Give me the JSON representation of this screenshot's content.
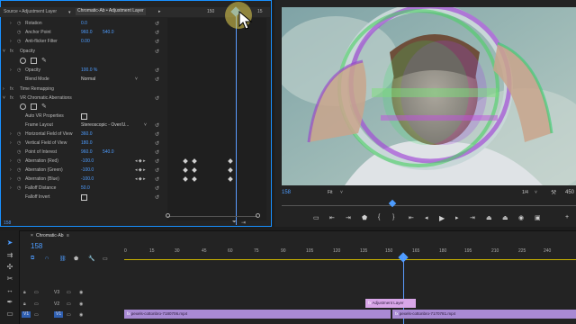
{
  "effect_controls": {
    "source_label": "Source • Adjustment Layer",
    "clip_label": "Chromatic-Ab • Adjustment Layer",
    "timecode_ruler": [
      "150",
      "15"
    ],
    "current_time": "158",
    "rows": [
      {
        "label": "Rotation",
        "v1": "0.0",
        "v2": ""
      },
      {
        "label": "Anchor Point",
        "v1": "960.0",
        "v2": "540.0"
      },
      {
        "label": "Anti-flicker Filter",
        "v1": "0.00",
        "v2": ""
      },
      {
        "label": "Opacity",
        "v1": "",
        "v2": "",
        "section": true
      },
      {
        "label": "",
        "v1": "",
        "v2": "",
        "masks": true
      },
      {
        "label": "Opacity",
        "v1": "100.0 %",
        "v2": ""
      },
      {
        "label": "Blend Mode",
        "v1": "Normal",
        "v2": ""
      },
      {
        "label": "Time Remapping",
        "v1": "",
        "v2": "",
        "section": true
      },
      {
        "label": "VR Chromatic Aberrations",
        "v1": "",
        "v2": "",
        "section": true
      },
      {
        "label": "",
        "v1": "",
        "v2": "",
        "masks": true
      },
      {
        "label": "Auto VR Properties",
        "v1": "",
        "v2": "",
        "checkbox": true
      },
      {
        "label": "Frame Layout",
        "v1": "Stereoscopic - Over/U...",
        "v2": ""
      },
      {
        "label": "Horizontal Field of View",
        "v1": "360.0",
        "v2": ""
      },
      {
        "label": "Vertical Field of View",
        "v1": "180.0",
        "v2": ""
      },
      {
        "label": "Point of Interest",
        "v1": "960.0",
        "v2": "540.0"
      },
      {
        "label": "Aberration (Red)",
        "v1": "-100.0",
        "v2": ""
      },
      {
        "label": "Aberration (Green)",
        "v1": "-100.0",
        "v2": ""
      },
      {
        "label": "Aberration (Blue)",
        "v1": "-100.0",
        "v2": ""
      },
      {
        "label": "Falloff Distance",
        "v1": "50.0",
        "v2": ""
      },
      {
        "label": "Falloff Invert",
        "v1": "",
        "v2": "",
        "checkbox": true
      }
    ]
  },
  "program_monitor": {
    "current_time": "158",
    "fit": "Fit",
    "quality": "1/4",
    "duration": "450"
  },
  "timeline": {
    "sequence_name": "Chromatic-Ab",
    "current_time": "158",
    "ruler_ticks": [
      "0",
      "15",
      "30",
      "45",
      "60",
      "75",
      "90",
      "105",
      "120",
      "135",
      "150",
      "165",
      "180",
      "195",
      "210",
      "225",
      "240"
    ],
    "tracks": [
      "V3",
      "V2",
      "V1"
    ],
    "adjustment_clip": "Adjustment Layer",
    "clip_a": "pexels-cottonbro-7180706.mp4",
    "clip_b": "pexels-cottonbro-7170781.mp4"
  },
  "colors": {
    "accent": "#4d9cff",
    "clip": "#a98ad4",
    "adjust_clip": "#d9a6e8",
    "in_out": "#c9b200"
  }
}
